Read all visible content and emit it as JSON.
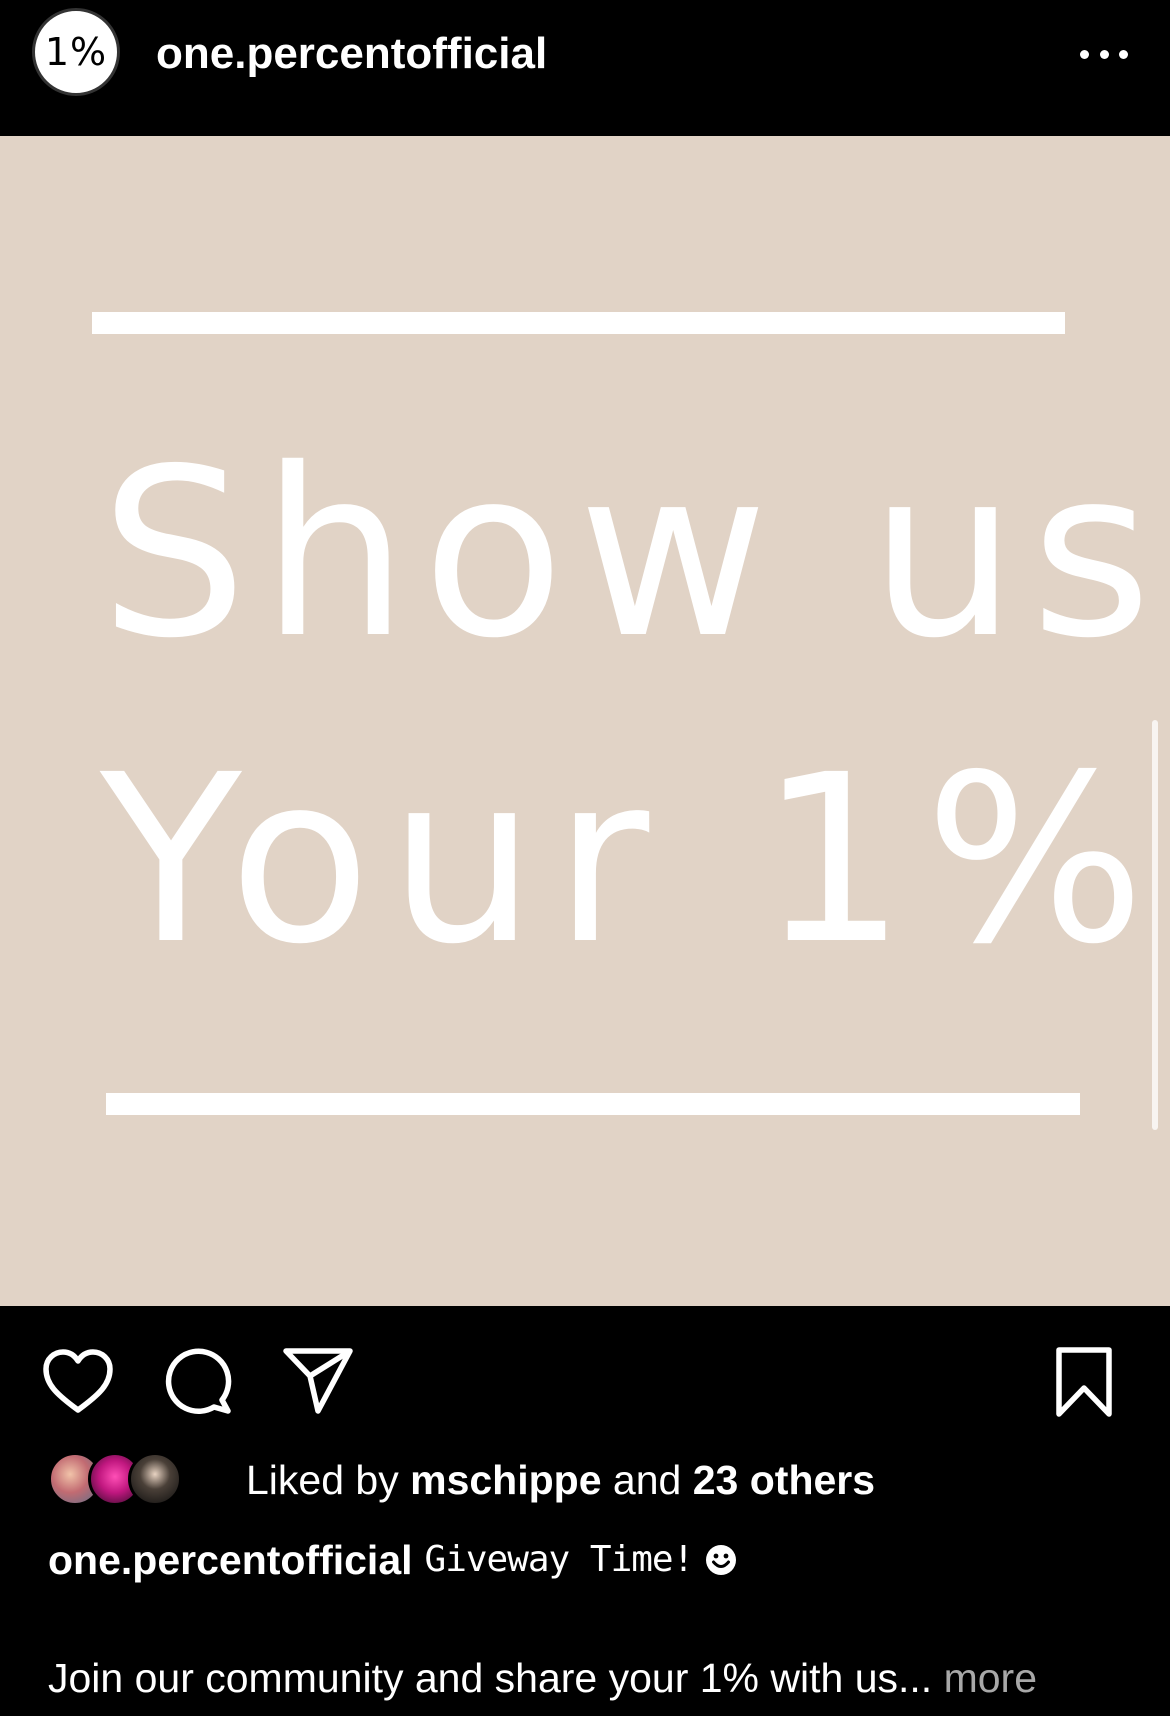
{
  "header": {
    "avatar_text": "1%",
    "username": "one.percentofficial",
    "more_icon": "more-horizontal-icon"
  },
  "post": {
    "line1": "Show us",
    "line2": "Your 1%",
    "background_color": "#e1d3c6"
  },
  "actions": {
    "like_icon": "heart-icon",
    "comment_icon": "comment-bubble-icon",
    "share_icon": "paper-plane-icon",
    "save_icon": "bookmark-icon"
  },
  "likes": {
    "prefix": "Liked by",
    "user": "mschippe",
    "joiner": "and",
    "others": "23 others"
  },
  "caption": {
    "username": "one.percentofficial",
    "text": "Giveway Time!",
    "emoji_icon": "smiley-icon",
    "body": "Join our community and share your 1% with us...",
    "more_label": "more"
  }
}
